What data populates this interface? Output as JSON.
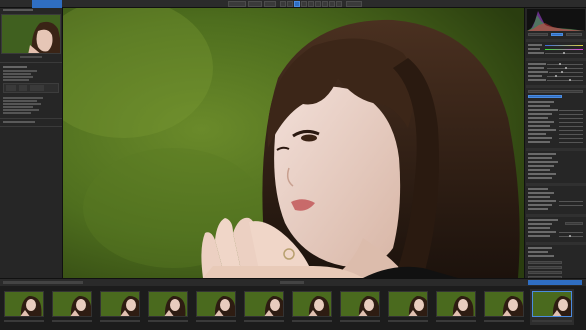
{
  "app": {
    "tabs": [
      {
        "label": "",
        "active": false
      },
      {
        "label": "",
        "active": true
      }
    ]
  },
  "viewer": {
    "subject": "portrait-photo"
  },
  "histogram": {
    "colors": [
      "#e23a3a",
      "#3ae23a",
      "#3a6ae2",
      "#ffffff"
    ]
  },
  "filmstrip": {
    "count": 12,
    "selected_index": 11
  },
  "colors": {
    "accent": "#2f6ec2",
    "panel": "#262626",
    "background": "#1e1e1e"
  }
}
